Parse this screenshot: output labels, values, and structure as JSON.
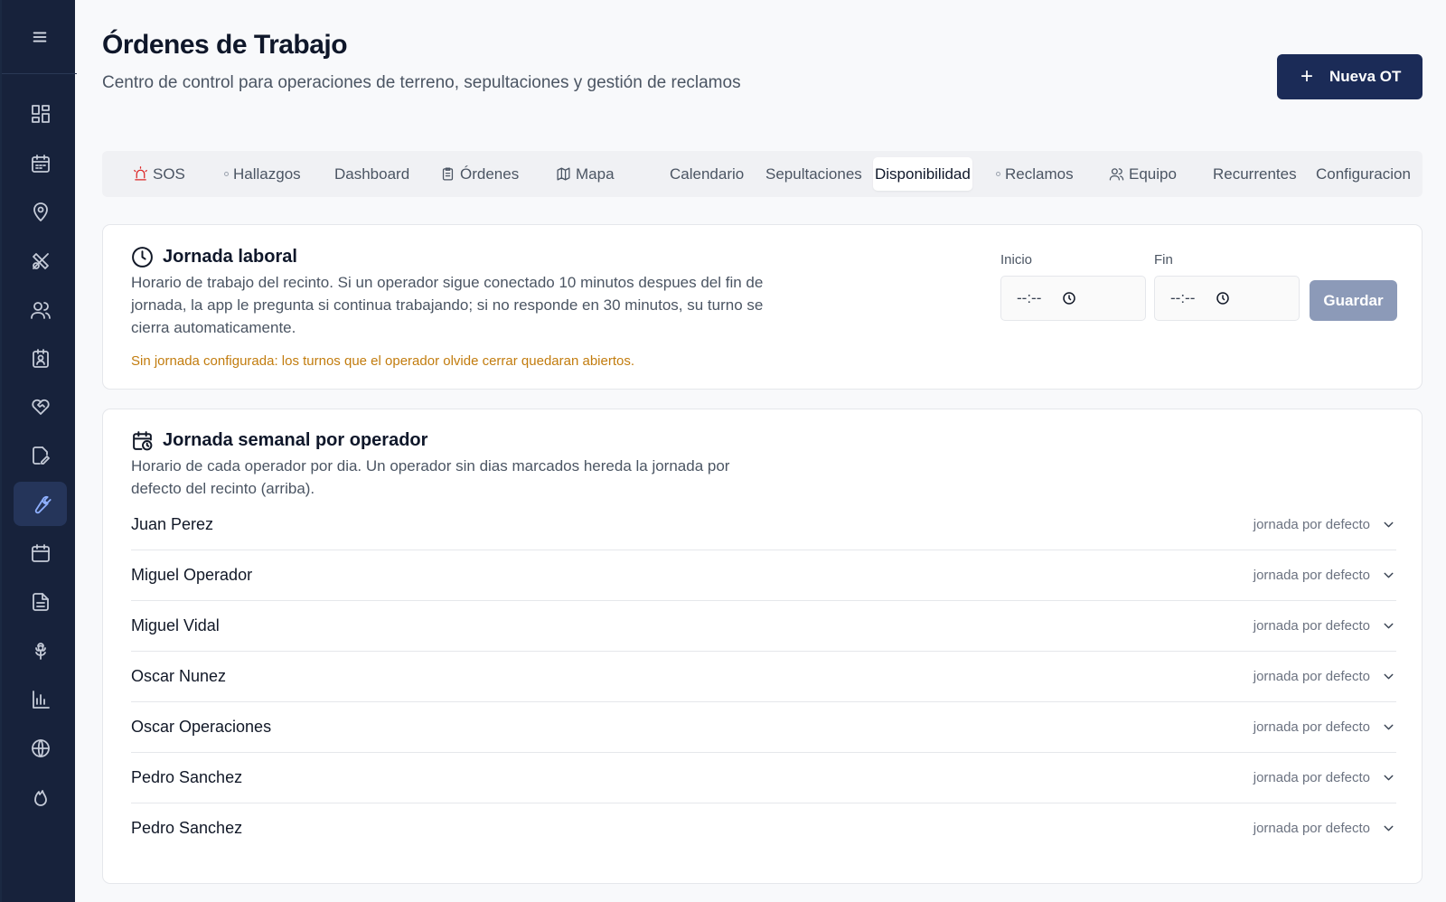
{
  "header": {
    "title": "Órdenes de Trabajo",
    "subtitle": "Centro de control para operaciones de terreno, sepultaciones y gestión de reclamos",
    "new_button": "Nueva OT"
  },
  "sidebar": {
    "items": [
      {
        "icon": "dashboard-icon"
      },
      {
        "icon": "calendar-icon"
      },
      {
        "icon": "map-pin-icon"
      },
      {
        "icon": "tools-icon"
      },
      {
        "icon": "users-icon"
      },
      {
        "icon": "id-badge-icon"
      },
      {
        "icon": "heart-handshake-icon"
      },
      {
        "icon": "file-edit-icon"
      },
      {
        "icon": "wrench-icon",
        "active": true
      },
      {
        "icon": "calendar-small-icon"
      },
      {
        "icon": "document-icon"
      },
      {
        "icon": "flower-icon"
      },
      {
        "icon": "bar-chart-icon"
      },
      {
        "icon": "globe-icon"
      },
      {
        "icon": "flame-icon"
      }
    ]
  },
  "tabs": [
    {
      "label": "SOS",
      "icon": "siren-icon"
    },
    {
      "label": "Hallazgos",
      "icon": "dot-icon"
    },
    {
      "label": "Dashboard"
    },
    {
      "label": "Órdenes",
      "icon": "clipboard-icon"
    },
    {
      "label": "Mapa",
      "icon": "map-icon"
    },
    {
      "label": "Calendario"
    },
    {
      "label": "Sepultaciones"
    },
    {
      "label": "Disponibilidad",
      "active": true
    },
    {
      "label": "Reclamos",
      "icon": "dot-icon"
    },
    {
      "label": "Equipo",
      "icon": "users-icon"
    },
    {
      "label": "Recurrentes"
    },
    {
      "label": "Configuracion"
    }
  ],
  "jornada": {
    "title": "Jornada laboral",
    "description": "Horario de trabajo del recinto. Si un operador sigue conectado 10 minutos despues del fin de jornada, la app le pregunta si continua trabajando; si no responde en 30 minutos, su turno se cierra automaticamente.",
    "warning": "Sin jornada configurada: los turnos que el operador olvide cerrar quedaran abiertos.",
    "start_label": "Inicio",
    "start_value": "--:--",
    "end_label": "Fin",
    "end_value": "--:--",
    "save_label": "Guardar"
  },
  "semanal": {
    "title": "Jornada semanal por operador",
    "description": "Horario de cada operador por dia. Un operador sin dias marcados hereda la jornada por defecto del recinto (arriba).",
    "operators": [
      {
        "name": "Juan Perez",
        "status": "jornada por defecto"
      },
      {
        "name": "Miguel Operador",
        "status": "jornada por defecto"
      },
      {
        "name": "Miguel Vidal",
        "status": "jornada por defecto"
      },
      {
        "name": "Oscar Nunez",
        "status": "jornada por defecto"
      },
      {
        "name": "Oscar Operaciones",
        "status": "jornada por defecto"
      },
      {
        "name": "Pedro Sanchez",
        "status": "jornada por defecto"
      },
      {
        "name": "Pedro Sanchez",
        "status": "jornada por defecto"
      }
    ]
  },
  "colors": {
    "sidebar_bg": "#17223b",
    "primary": "#1b2b57",
    "warning": "#c27c0e"
  }
}
